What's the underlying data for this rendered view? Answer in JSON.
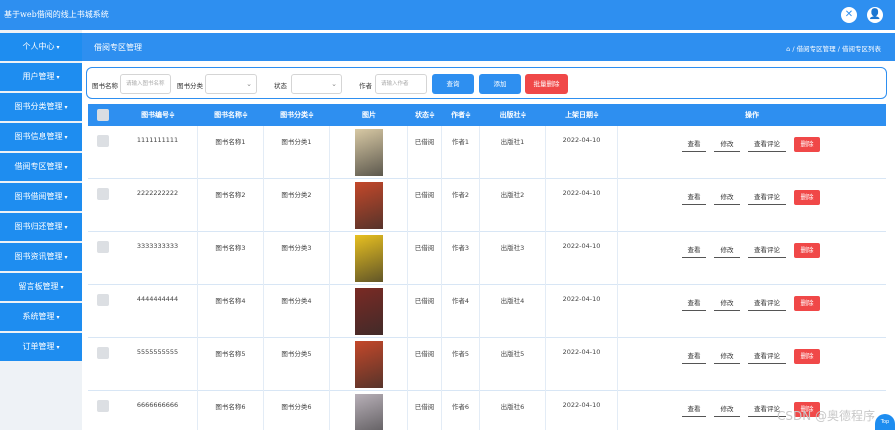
{
  "app": {
    "title": "基于web借阅的线上书城系统"
  },
  "topbar_icons": [
    {
      "name": "close-icon",
      "glyph": "✕"
    },
    {
      "name": "user-icon",
      "glyph": "👤"
    }
  ],
  "sidebar": {
    "items": [
      {
        "label": "个人中心"
      },
      {
        "label": "用户管理"
      },
      {
        "label": "图书分类管理"
      },
      {
        "label": "图书信息管理"
      },
      {
        "label": "借阅专区管理"
      },
      {
        "label": "图书借阅管理"
      },
      {
        "label": "图书归还管理"
      },
      {
        "label": "图书资讯管理"
      },
      {
        "label": "留言板管理"
      },
      {
        "label": "系统管理"
      },
      {
        "label": "订单管理"
      }
    ]
  },
  "header": {
    "title": "借阅专区管理",
    "breadcrumb": {
      "home_icon": "⌂",
      "sep": "/",
      "items": [
        "借阅专区管理",
        "借阅专区列表"
      ]
    }
  },
  "filters": {
    "book_name_label": "图书名称",
    "book_name_placeholder": "请输入图书名称",
    "category_label": "图书分类",
    "status_label": "状态",
    "author_label": "作者",
    "author_placeholder": "请输入作者",
    "search_label": "查询",
    "add_label": "添加",
    "batch_delete_label": "批量删除"
  },
  "table": {
    "headers": [
      "图书编号",
      "图书名称",
      "图书分类",
      "图片",
      "状态",
      "作者",
      "出版社",
      "上架日期",
      "操作"
    ],
    "sort_mark": "≑",
    "actions": {
      "view": "查看",
      "edit": "修改",
      "comments": "查看评论",
      "delete": "删除"
    },
    "rows": [
      {
        "id": "1111111111",
        "name": "图书名称1",
        "category": "图书分类1",
        "status": "已借阅",
        "author": "作者1",
        "publisher": "出版社1",
        "date": "2022-04-10",
        "cover": "#d8c9a4"
      },
      {
        "id": "2222222222",
        "name": "图书名称2",
        "category": "图书分类2",
        "status": "已借阅",
        "author": "作者2",
        "publisher": "出版社2",
        "date": "2022-04-10",
        "cover": "#c4482a"
      },
      {
        "id": "3333333333",
        "name": "图书名称3",
        "category": "图书分类3",
        "status": "已借阅",
        "author": "作者3",
        "publisher": "出版社3",
        "date": "2022-04-10",
        "cover": "#e8c020"
      },
      {
        "id": "4444444444",
        "name": "图书名称4",
        "category": "图书分类4",
        "status": "已借阅",
        "author": "作者4",
        "publisher": "出版社4",
        "date": "2022-04-10",
        "cover": "#7a2a24"
      },
      {
        "id": "5555555555",
        "name": "图书名称5",
        "category": "图书分类5",
        "status": "已借阅",
        "author": "作者5",
        "publisher": "出版社5",
        "date": "2022-04-10",
        "cover": "#c4482a"
      },
      {
        "id": "6666666666",
        "name": "图书名称6",
        "category": "图书分类6",
        "status": "已借阅",
        "author": "作者6",
        "publisher": "出版社6",
        "date": "2022-04-10",
        "cover": "#b8b0b8"
      }
    ]
  },
  "watermark": "CSDN @奥德程序",
  "top_button": "Top",
  "colors": {
    "primary": "#2e8ff0",
    "danger": "#f04848",
    "sidebar_bg": "#eef2f6"
  }
}
